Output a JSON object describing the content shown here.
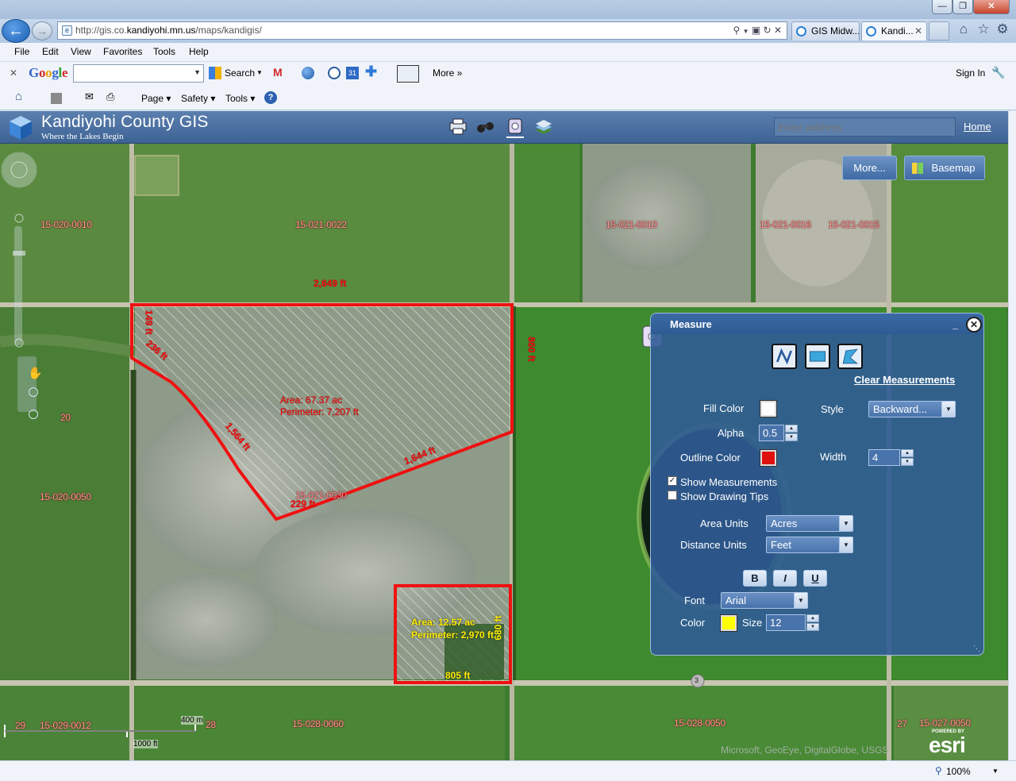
{
  "browser": {
    "url_prefix": "http://gis.co.",
    "url_domain": "kandiyohi.mn.us",
    "url_path": "/maps/kandigis/",
    "tabs": [
      {
        "label": "GIS Midw..."
      },
      {
        "label": "Kandi..."
      }
    ],
    "menu": [
      "File",
      "Edit",
      "View",
      "Favorites",
      "Tools",
      "Help"
    ],
    "google": {
      "logo": "Google",
      "search_label": "Search",
      "more_label": "More »",
      "sign_in": "Sign In"
    },
    "commands": {
      "page": "Page",
      "safety": "Safety",
      "tools": "Tools"
    },
    "zoom": "100%"
  },
  "app": {
    "title": "Kandiyohi County GIS",
    "subtitle": "Where the Lakes Begin",
    "address_placeholder": "Enter address",
    "home_link": "Home",
    "more_button": "More...",
    "basemap_button": "Basemap"
  },
  "map": {
    "parcels": [
      {
        "id": "15-020-0010"
      },
      {
        "id": "15-021-0022"
      },
      {
        "id": "15-021-0010"
      },
      {
        "id": "15-021-0016"
      },
      {
        "id": "15-021-0015"
      },
      {
        "id": "15-020-0050"
      },
      {
        "id": "15-021-0030"
      },
      {
        "id": "15-029-0012"
      },
      {
        "id": "15-028-0060"
      },
      {
        "id": "15-028-0050"
      },
      {
        "id": "15-027-0050"
      }
    ],
    "section_numbers": [
      "20",
      "29",
      "28",
      "27"
    ],
    "measurement1": {
      "area": "Area: 67.37 ac",
      "perimeter": "Perimeter: 7,207 ft",
      "segments": [
        "2,649 ft",
        "860 ft",
        "1,564 ft",
        "1,644 ft",
        "229 ft",
        "236 ft",
        "149 ft"
      ]
    },
    "measurement2": {
      "area": "Area: 12.57 ac",
      "perimeter": "Perimeter: 2,970 ft",
      "segments": [
        "805 ft",
        "680 ft"
      ]
    },
    "scale": {
      "metric": "400 m",
      "imperial": "1000 ft"
    },
    "attribution": "Microsoft, GeoEye, DigitalGlobe, USGS",
    "esri_powered": "POWERED BY",
    "esri_logo": "esri",
    "road_shield": "3"
  },
  "measure": {
    "title": "Measure",
    "clear_label": "Clear Measurements",
    "fill_color_label": "Fill Color",
    "style_label": "Style",
    "style_value": "Backward...",
    "alpha_label": "Alpha",
    "alpha_value": "0.5",
    "outline_color_label": "Outline Color",
    "width_label": "Width",
    "width_value": "4",
    "show_measurements": "Show Measurements",
    "show_tips": "Show Drawing Tips",
    "area_units_label": "Area Units",
    "area_units_value": "Acres",
    "distance_units_label": "Distance Units",
    "distance_units_value": "Feet",
    "bold": "B",
    "italic": "I",
    "underline": "U",
    "font_label": "Font",
    "font_value": "Arial",
    "color_label": "Color",
    "size_label": "Size",
    "size_value": "12",
    "fill_color": "#ffffff",
    "outline_color": "#e01010",
    "text_color": "#ffff00"
  }
}
